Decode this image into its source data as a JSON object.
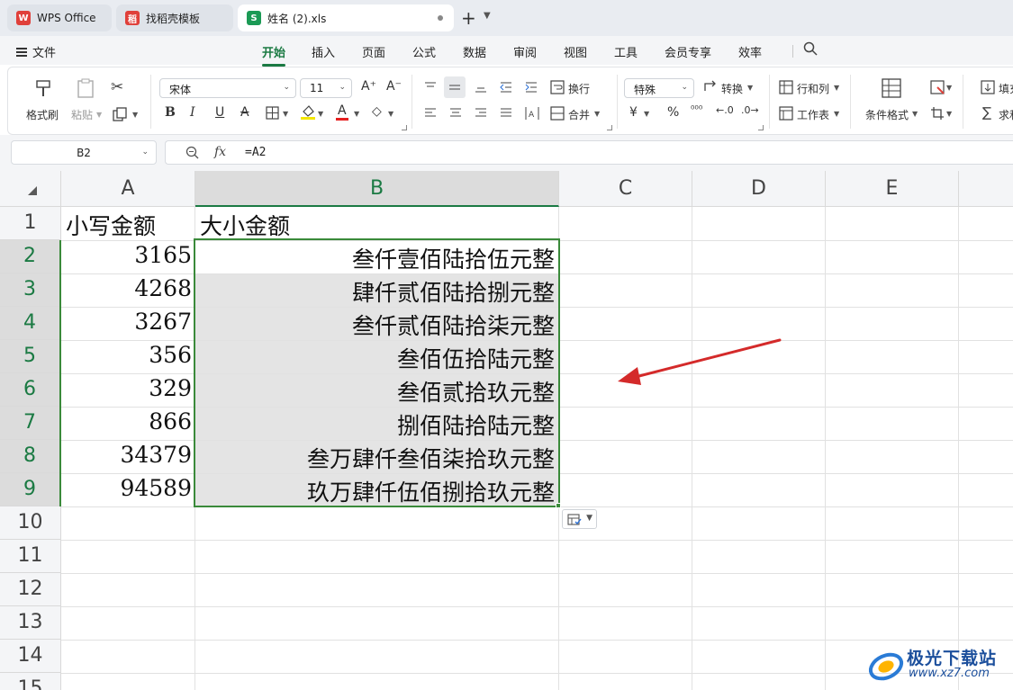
{
  "tabs": [
    {
      "label": "WPS Office",
      "logo": "W",
      "color": "#e0403a"
    },
    {
      "label": "找稻壳模板",
      "logo": "稻",
      "color": "#e0403a"
    },
    {
      "label": "姓名 (2).xls",
      "logo": "S",
      "color": "#1b9a55"
    }
  ],
  "menu": {
    "file": "文件",
    "tabs": [
      "开始",
      "插入",
      "页面",
      "公式",
      "数据",
      "审阅",
      "视图",
      "工具",
      "会员专享",
      "效率"
    ]
  },
  "ribbon": {
    "format_painter": "格式刷",
    "paste": "粘贴",
    "font_name": "宋体",
    "font_size": "11",
    "wrap": "换行",
    "merge": "合并",
    "number_format": "特殊",
    "convert": "转换",
    "rows_cols": "行和列",
    "worksheet": "工作表",
    "cond_format": "条件格式",
    "fill": "填充",
    "sum": "求和",
    "currency": "¥",
    "percent": "%"
  },
  "formula_bar": {
    "cell_ref": "B2",
    "fx": "fx",
    "formula": "=A2"
  },
  "sheet": {
    "columns": [
      "A",
      "B",
      "C",
      "D",
      "E"
    ],
    "rows": [
      "1",
      "2",
      "3",
      "4",
      "5",
      "6",
      "7",
      "8",
      "9",
      "10",
      "11",
      "12",
      "13",
      "14",
      "15"
    ],
    "header": {
      "A1": "小写金额",
      "B1": "大小金额"
    },
    "data": [
      {
        "a": "3165",
        "b": "叁仟壹佰陆拾伍元整"
      },
      {
        "a": "4268",
        "b": "肆仟贰佰陆拾捌元整"
      },
      {
        "a": "3267",
        "b": "叁仟贰佰陆拾柒元整"
      },
      {
        "a": "356",
        "b": "叁佰伍拾陆元整"
      },
      {
        "a": "329",
        "b": "叁佰贰拾玖元整"
      },
      {
        "a": "866",
        "b": "捌佰陆拾陆元整"
      },
      {
        "a": "34379",
        "b": "叁万肆仟叁佰柒拾玖元整"
      },
      {
        "a": "94589",
        "b": "玖万肆仟伍佰捌拾玖元整"
      }
    ]
  },
  "watermark": {
    "brand": "极光下载站",
    "url": "www.xz7.com"
  },
  "colors": {
    "accent": "#1b7a43",
    "selection": "#3a8a3a",
    "arrow": "#d42a2a"
  }
}
